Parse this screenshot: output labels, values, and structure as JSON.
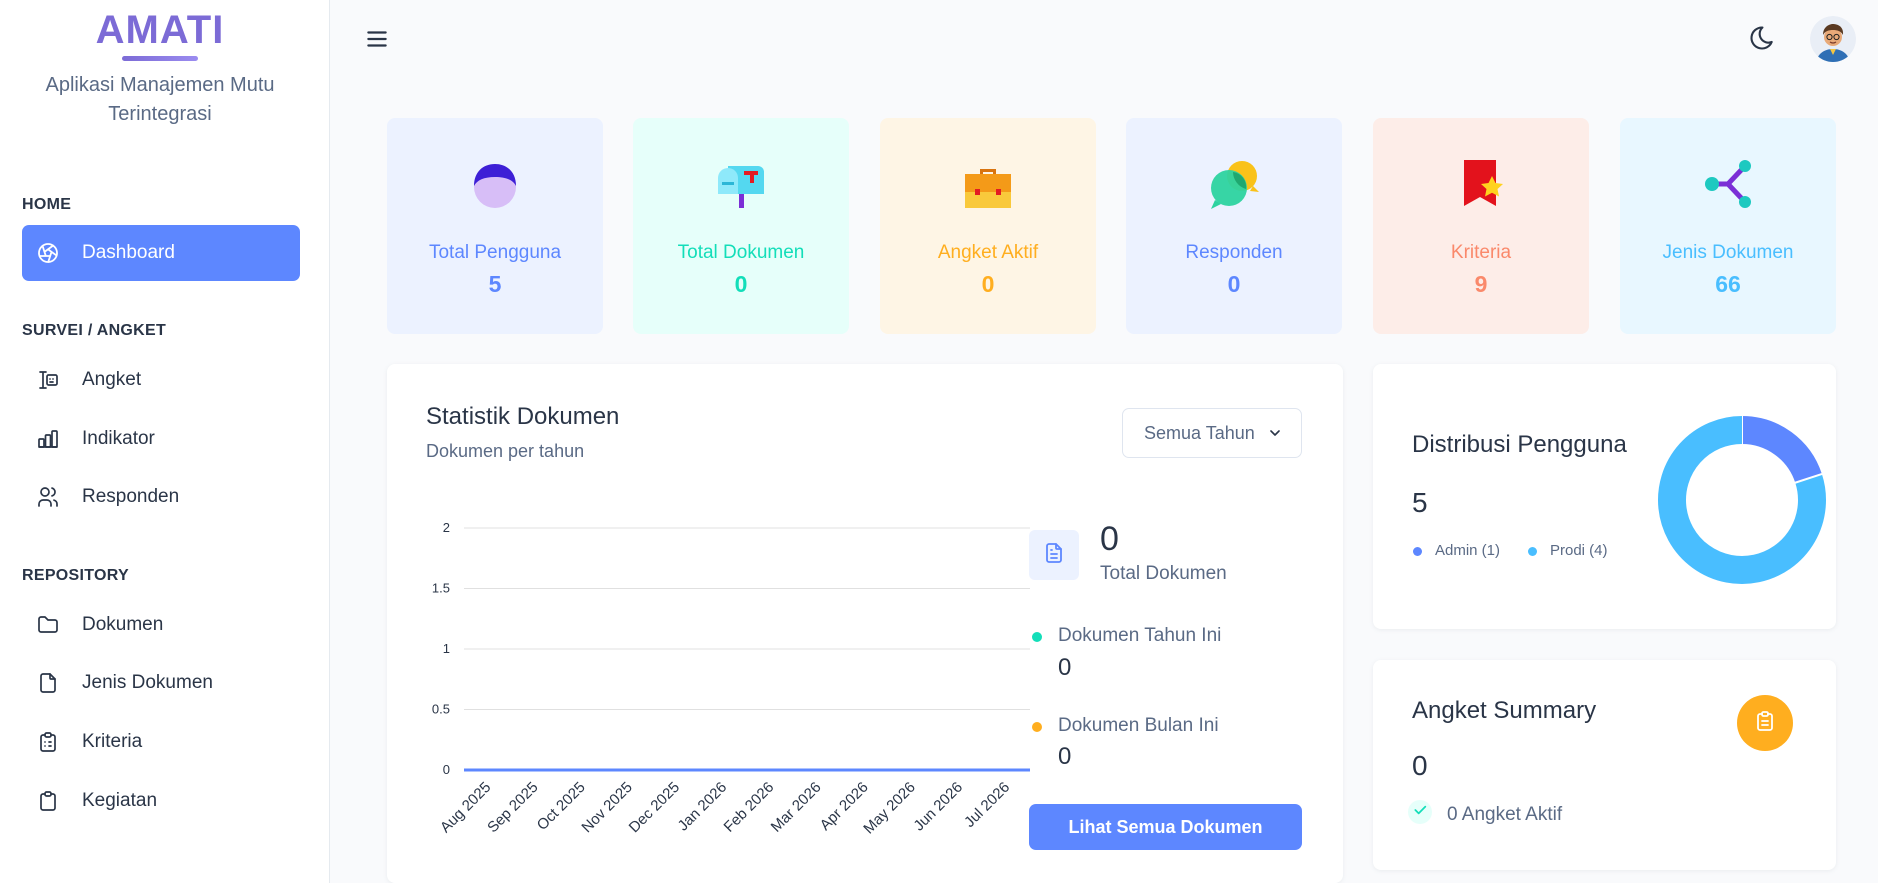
{
  "brand": {
    "name": "AMATI",
    "subtitle_line1": "Aplikasi Manajemen Mutu",
    "subtitle_line2": "Terintegrasi"
  },
  "sidebar": {
    "sections": [
      {
        "title": "HOME"
      },
      {
        "title": "SURVEI / ANGKET"
      },
      {
        "title": "REPOSITORY"
      }
    ],
    "items": [
      {
        "label": "Dashboard",
        "icon": "aperture-icon",
        "active": true
      },
      {
        "label": "Angket",
        "icon": "survey-icon"
      },
      {
        "label": "Indikator",
        "icon": "chart-bar-icon"
      },
      {
        "label": "Responden",
        "icon": "users-icon"
      },
      {
        "label": "Dokumen",
        "icon": "folder-icon"
      },
      {
        "label": "Jenis Dokumen",
        "icon": "file-icon"
      },
      {
        "label": "Kriteria",
        "icon": "clipboard-list-icon"
      },
      {
        "label": "Kegiatan",
        "icon": "clipboard-icon"
      }
    ]
  },
  "topbar": {
    "menu_icon": "menu-icon",
    "theme_icon": "moon-icon",
    "avatar": "user-avatar"
  },
  "stats": [
    {
      "label": "Total Pengguna",
      "value": "5",
      "color": "#5d87ff",
      "bg": "#ecf2ff",
      "icon": "user-icon"
    },
    {
      "label": "Total Dokumen",
      "value": "0",
      "color": "#13deb9",
      "bg": "#e6fffa",
      "icon": "mailbox-icon"
    },
    {
      "label": "Angket Aktif",
      "value": "0",
      "color": "#ffae1f",
      "bg": "#fef5e5",
      "icon": "briefcase-icon"
    },
    {
      "label": "Responden",
      "value": "0",
      "color": "#5d87ff",
      "bg": "#ecf2ff",
      "icon": "chat-bubbles-icon"
    },
    {
      "label": "Kriteria",
      "value": "9",
      "color": "#fa896b",
      "bg": "#fdede8",
      "icon": "flag-star-icon"
    },
    {
      "label": "Jenis Dokumen",
      "value": "66",
      "color": "#49beff",
      "bg": "#e8f7ff",
      "icon": "share-icon"
    }
  ],
  "statistik": {
    "title": "Statistik Dokumen",
    "subtitle": "Dokumen per tahun",
    "filter": "Semua Tahun",
    "total_value": "0",
    "total_label": "Total Dokumen",
    "tahun_ini_label": "Dokumen Tahun Ini",
    "tahun_ini_value": "0",
    "bulan_ini_label": "Dokumen Bulan Ini",
    "bulan_ini_value": "0",
    "button": "Lihat Semua Dokumen",
    "colors": {
      "line": "#5d87ff",
      "tahun_ini": "#13deb9",
      "bulan_ini": "#ffae1f"
    }
  },
  "chart_data": {
    "type": "line",
    "x": [
      "Aug 2025",
      "Sep 2025",
      "Oct 2025",
      "Nov 2025",
      "Dec 2025",
      "Jan 2026",
      "Feb 2026",
      "Mar 2026",
      "Apr 2026",
      "May 2026",
      "Jun 2026",
      "Jul 2026"
    ],
    "series": [
      {
        "values": [
          0,
          0,
          0,
          0,
          0,
          0,
          0,
          0,
          0,
          0,
          0,
          0
        ]
      }
    ],
    "y_ticks": [
      "0",
      "0.5",
      "1",
      "1.5",
      "2"
    ],
    "ylim": [
      0,
      2
    ],
    "grid": true,
    "title": "",
    "xlabel": "",
    "ylabel": ""
  },
  "distribusi": {
    "title": "Distribusi Pengguna",
    "total": "5",
    "legend": [
      {
        "label": "Admin (1)",
        "value": 1,
        "color": "#5d87ff"
      },
      {
        "label": "Prodi (4)",
        "value": 4,
        "color": "#49beff"
      }
    ]
  },
  "summary": {
    "title": "Angket Summary",
    "value": "0",
    "active_label": "0 Angket Aktif",
    "badge_icon": "clipboard-icon",
    "check_icon": "check-icon"
  }
}
